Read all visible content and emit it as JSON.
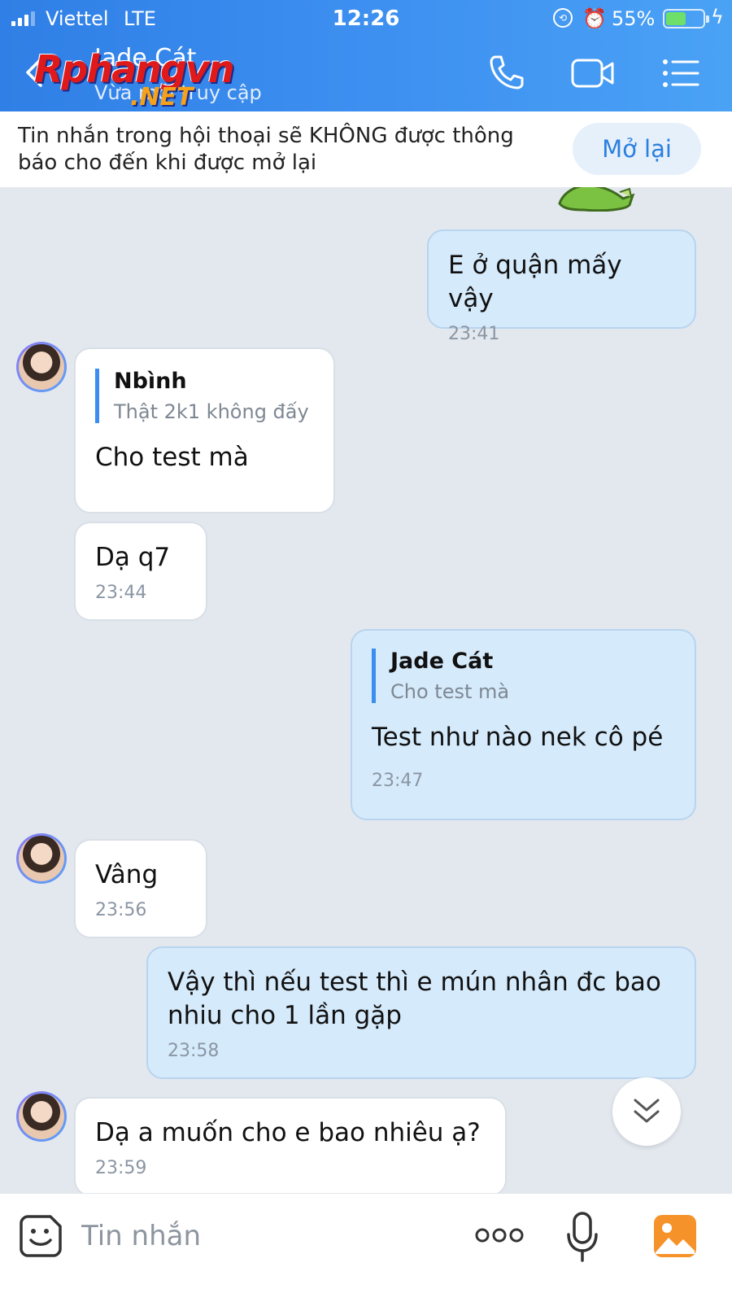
{
  "status_bar": {
    "carrier": "Viettel",
    "network": "LTE",
    "time": "12:26",
    "battery_percent": "55%",
    "battery_level": 0.55
  },
  "header": {
    "contact_name": "Jade Cát",
    "contact_status": "Vừa mới truy cập",
    "watermark_main": "Rphangvn",
    "watermark_sub": ".NET"
  },
  "notice": {
    "text": "Tin nhắn trong hội thoại sẽ KHÔNG được thông báo cho đến khi được mở lại",
    "reopen_label": "Mở lại"
  },
  "messages": [
    {
      "dir": "out",
      "text": "E ở quận mấy vậy",
      "time": "23:41"
    },
    {
      "dir": "in",
      "quote_name": "Nbình",
      "quote_text": "Thật 2k1 không đấy",
      "text": "Cho test mà"
    },
    {
      "dir": "in",
      "text": "Dạ q7",
      "time": "23:44"
    },
    {
      "dir": "out",
      "quote_name": "Jade Cát",
      "quote_text": "Cho test mà",
      "text": "Test như nào nek cô pé",
      "time": "23:47"
    },
    {
      "dir": "in",
      "text": "Vâng",
      "time": "23:56"
    },
    {
      "dir": "out",
      "text": "Vậy thì nếu test thì e mún nhân đc bao nhiu cho 1 lần gặp",
      "time": "23:58"
    },
    {
      "dir": "in",
      "text": "Dạ a muốn cho e bao nhiêu ạ?",
      "time": "23:59"
    }
  ],
  "input": {
    "placeholder": "Tin nhắn"
  },
  "icons": {
    "call": "phone-icon",
    "video": "video-camera-icon",
    "menu": "list-menu-icon",
    "emoji": "sticker-icon",
    "more": "more-icon",
    "mic": "microphone-icon",
    "gallery": "image-icon"
  },
  "colors": {
    "header": "#3d8ff0",
    "outgoing_bubble": "#d5eafb",
    "incoming_bubble": "#ffffff",
    "accent": "#2a7fe0",
    "gallery_icon": "#f5932a"
  }
}
